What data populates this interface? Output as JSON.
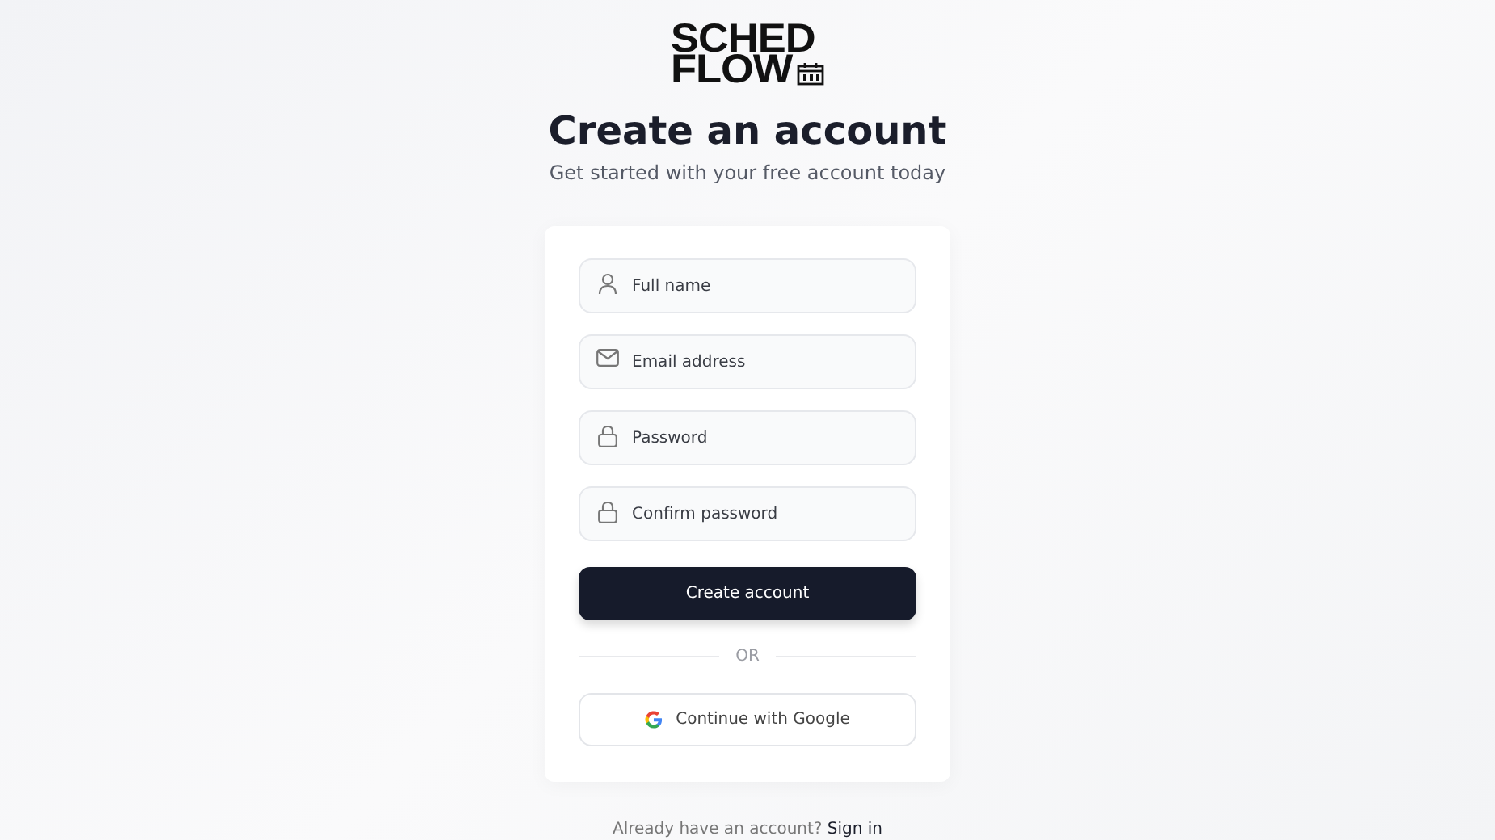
{
  "logo": {
    "line_1": "SCHED",
    "line_2": "FLOW"
  },
  "heading": "Create an account",
  "subheading": "Get started with your free account today",
  "fields": [
    {
      "kind": "name",
      "placeholder": "Full name"
    },
    {
      "kind": "email",
      "placeholder": "Email address"
    },
    {
      "kind": "password",
      "placeholder": "Password"
    },
    {
      "kind": "password",
      "placeholder": "Confirm password"
    }
  ],
  "submit_button": "Create account",
  "divider_text": "OR",
  "google_button": "Continue with Google",
  "footer": {
    "text": "Already have an account?",
    "link": "Sign in"
  }
}
